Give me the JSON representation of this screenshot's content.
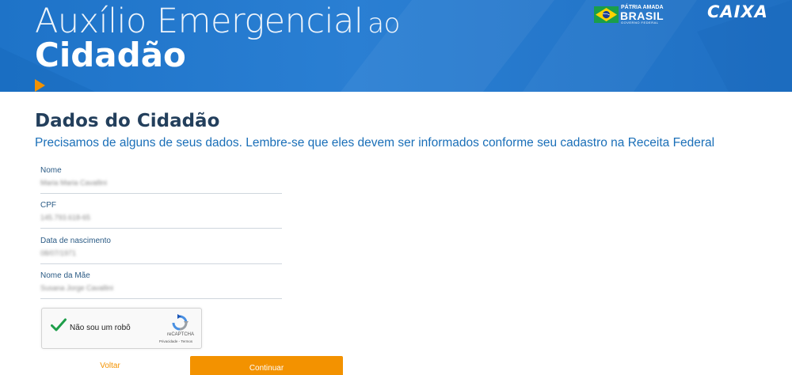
{
  "header": {
    "title_line1_main": "Auxílio Emergencial",
    "title_line1_small": "ao",
    "title_line2": "Cidadão",
    "gov_logo": {
      "top_text": "PÁTRIA AMADA",
      "main_text": "BRASIL",
      "bottom_text": "GOVERNO FEDERAL"
    },
    "caixa_logo": "CAIXA"
  },
  "form": {
    "title": "Dados do Cidadão",
    "subtitle": "Precisamos de alguns de seus dados. Lembre-se que eles devem ser informados conforme seu cadastro na Receita Federal",
    "fields": [
      {
        "label": "Nome",
        "value": "Maria Maria Cavallini"
      },
      {
        "label": "CPF",
        "value": "145.793.618-65"
      },
      {
        "label": "Data de nascimento",
        "value": "08/07/1971"
      },
      {
        "label": "Nome da Mãe",
        "value": "Susana Jorge Cavallini"
      }
    ]
  },
  "captcha": {
    "label": "Não sou um robô",
    "brand": "reCAPTCHA",
    "links": "Privacidade - Termos",
    "checked": true
  },
  "actions": {
    "back_label": "Voltar",
    "continue_label": "Continuar"
  },
  "colors": {
    "banner_blue": "#1e73c8",
    "accent_orange": "#f39200",
    "title_dark": "#233f5c",
    "subtitle_blue": "#1a6fb8",
    "check_green": "#1e9e4a"
  },
  "icons": {
    "captcha_check": "checkmark-icon",
    "captcha_logo": "recaptcha-icon",
    "gov_flag": "brazil-flag-icon"
  }
}
